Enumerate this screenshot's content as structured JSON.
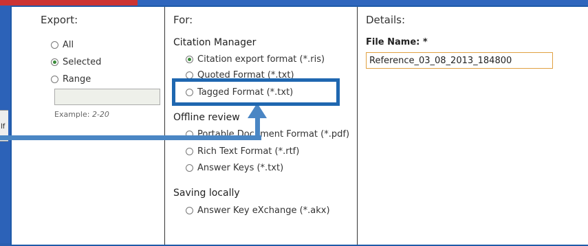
{
  "columns": {
    "export": "Export:",
    "for": "For:",
    "details": "Details:"
  },
  "export_options": [
    {
      "label": "All",
      "checked": false
    },
    {
      "label": "Selected",
      "checked": true
    },
    {
      "label": "Range",
      "checked": false
    }
  ],
  "range": {
    "example_prefix": "Example:",
    "example_value": "2-20"
  },
  "sections": {
    "citation_manager": "Citation Manager",
    "offline_review": "Offline review",
    "saving_locally": "Saving locally"
  },
  "citation_options": [
    {
      "label": "Citation export format (*.ris)",
      "checked": true
    },
    {
      "label": "Quoted Format (*.txt)",
      "checked": false
    },
    {
      "label": "Tagged Format (*.txt)",
      "checked": false
    }
  ],
  "offline_options": [
    {
      "label": "Portable Document Format (*.pdf)",
      "checked": false
    },
    {
      "label": "Rich Text Format (*.rtf)",
      "checked": false
    },
    {
      "label": "Answer Keys (*.txt)",
      "checked": false
    }
  ],
  "saving_options": [
    {
      "label": "Answer Key eXchange (*.akx)",
      "checked": false
    }
  ],
  "details": {
    "file_label": "File Name: *",
    "file_value": "Reference_03_08_2013_184800"
  },
  "background_fragment": "lf"
}
